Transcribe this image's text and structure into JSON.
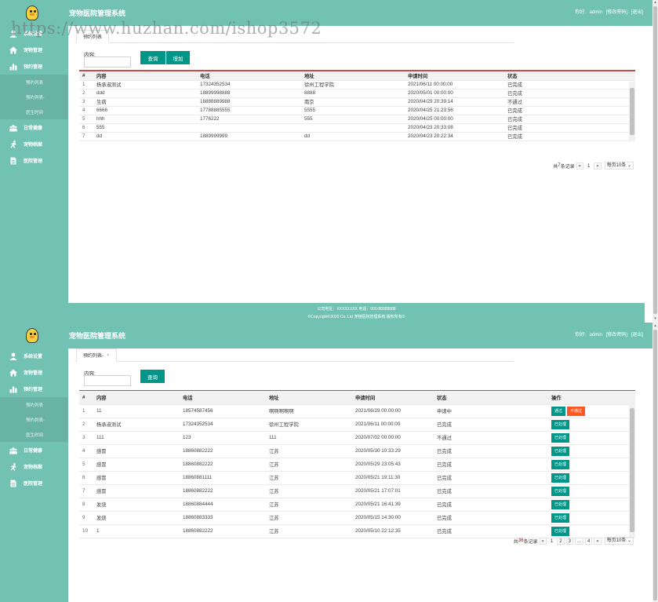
{
  "app_title": "宠物医院管理系统",
  "user": {
    "greeting": "你好:",
    "name": "admin",
    "change_password": "[修改密码]",
    "logout": "[退出]"
  },
  "sidebar": {
    "items": [
      {
        "label": "系统设置",
        "icon": "user-icon"
      },
      {
        "label": "宠物管理",
        "icon": "home-icon"
      },
      {
        "label": "预约管理",
        "icon": "bar-chart-icon"
      },
      {
        "label": "日常健康",
        "icon": "group-icon"
      },
      {
        "label": "宠物档案",
        "icon": "running-icon"
      },
      {
        "label": "医院管理",
        "icon": "document-icon"
      }
    ],
    "subitems": [
      "预约列表",
      "预约列表-",
      "医生时间"
    ]
  },
  "panel1": {
    "tab_label": "预约列表",
    "search_label": "内容:",
    "query_button": "查询",
    "add_button": "增加",
    "columns": [
      "#",
      "内容",
      "电话",
      "地址",
      "申请时间",
      "状态"
    ],
    "rows": [
      [
        "1",
        "杨承淑测试",
        "17324352534",
        "徐州工程学院",
        "2021/06/11 00:00:00",
        "已完成"
      ],
      [
        "2",
        "ddd",
        "18899998888",
        "8888",
        "2020/05/01 00:00:00",
        "已完成"
      ],
      [
        "3",
        "生病",
        "18888889988",
        "南京",
        "2020/04/29 20:39:14",
        "不通过"
      ],
      [
        "4",
        "6666",
        "17788885555",
        "5555",
        "2020/04/25 21:23:56",
        "已完成"
      ],
      [
        "5",
        "hhh",
        "1776222",
        "555",
        "2020/04/25 00:00:00",
        "已完成"
      ],
      [
        "6",
        "555",
        "",
        "",
        "2020/04/23 20:33:08",
        "已完成"
      ],
      [
        "7",
        "dd",
        "1889999999",
        "dd",
        "2020/04/23 20:22:34",
        "已完成"
      ]
    ],
    "pager": {
      "total_prefix": "共",
      "total_count": "7",
      "total_suffix": "条记录",
      "prev": "«",
      "page": "1",
      "next": "»",
      "per_page": "每页10条 ⌄"
    }
  },
  "footer": {
    "line1": "公司地址：XXXXXXXX 电话：000-88888888",
    "line2": "©Copyright©2020 Co. Ltd 宠物医院管理系统 版权所有©"
  },
  "panel2": {
    "tab_label": "预约列表-",
    "tab_close": "×",
    "search_label": "内容:",
    "query_button": "查询",
    "columns": [
      "#",
      "内容",
      "电话",
      "地址",
      "申请时间",
      "状态",
      "操作"
    ],
    "rows": [
      [
        "1",
        "11",
        "18574587456",
        "啊啊啊啊啊",
        "2021/06/29 00:00:00",
        "申请中"
      ],
      [
        "2",
        "杨承淑测试",
        "17324352534",
        "徐州工程学院",
        "2021/06/11 00:00:00",
        "已完成"
      ],
      [
        "3",
        "111",
        "123",
        "111",
        "2020/07/02 00:00:00",
        "不通过"
      ],
      [
        "4",
        "感冒",
        "18860882222",
        "江苏",
        "2020/05/30 10:33:29",
        "已完成"
      ],
      [
        "5",
        "感冒",
        "18860882222",
        "江苏",
        "2020/05/29 23:05:43",
        "已完成"
      ],
      [
        "6",
        "感冒",
        "18860881111",
        "江苏",
        "2020/05/21 19:11:30",
        "已完成"
      ],
      [
        "7",
        "感冒",
        "18860882222",
        "江苏",
        "2020/05/21 17:07:01",
        "已完成"
      ],
      [
        "8",
        "发烧",
        "18860884444",
        "江苏",
        "2020/05/21 16:41:39",
        "已完成"
      ],
      [
        "9",
        "发烧",
        "18860883333",
        "江苏",
        "2020/05/15 14:30:00",
        "已完成"
      ],
      [
        "10",
        "1",
        "18860882222",
        "江苏",
        "2020/05/10 22:12:35",
        "已完成"
      ]
    ],
    "ops": {
      "approve": "通过",
      "reject": "不通过",
      "processed": "已处理"
    },
    "pager": {
      "total_prefix": "共",
      "total_count": "36",
      "total_suffix": "条记录",
      "prev": "«",
      "pages": [
        "1",
        "2",
        "3",
        "...",
        "4"
      ],
      "next": "»",
      "per_page": "每页10条 ⌄"
    }
  },
  "watermark": "https://www.huzhan.com/ishop3572"
}
